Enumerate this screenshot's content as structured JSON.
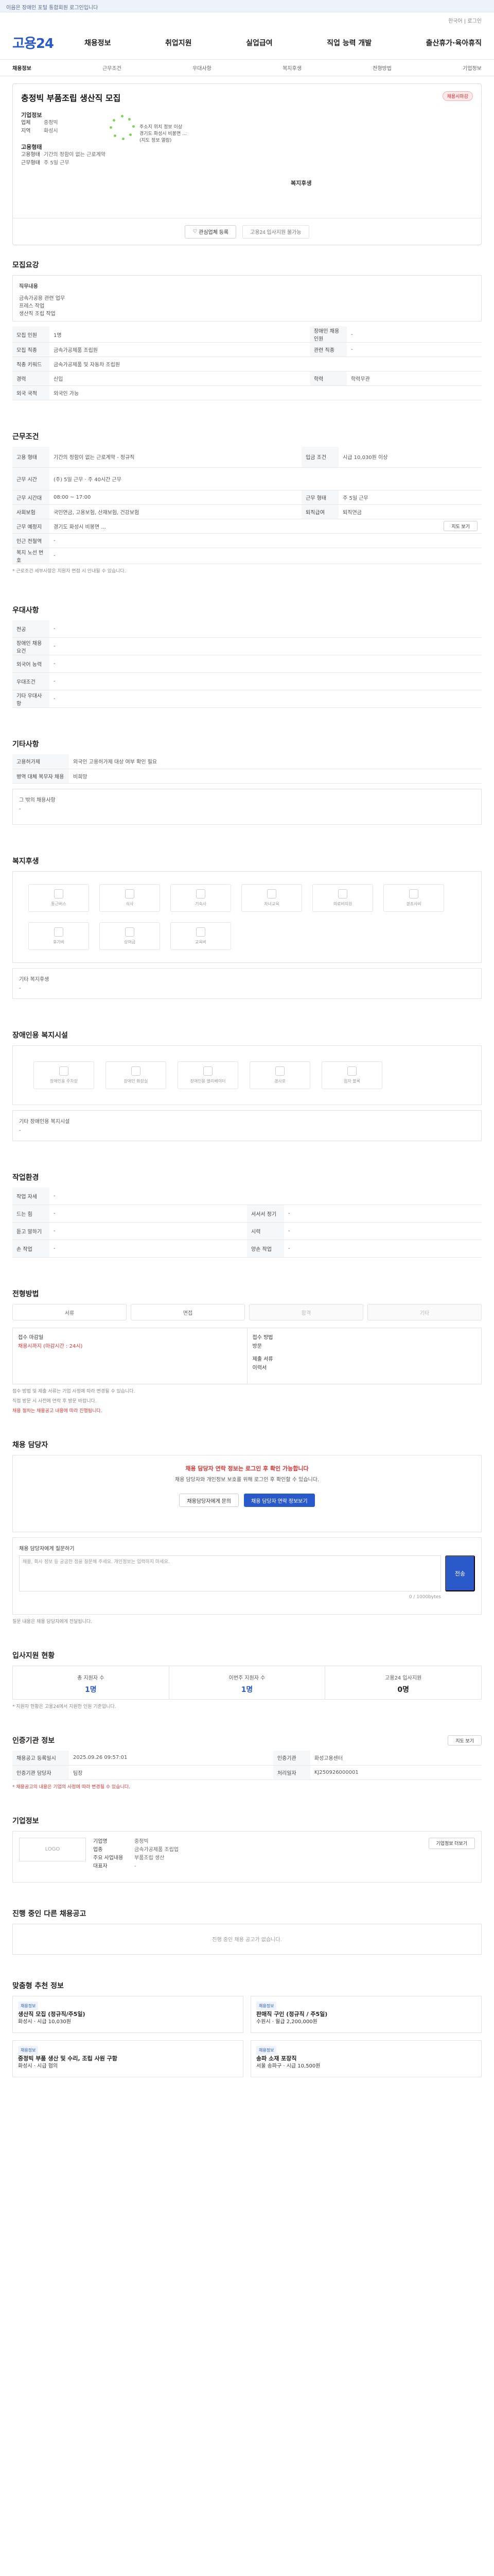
{
  "topbar": {
    "text": "이음은 장애인 포털 통합회원 로그인입니다"
  },
  "lang": {
    "label": "한국어 | 로그인"
  },
  "header": {
    "logo": "고용24",
    "menu": [
      "채용정보",
      "취업지원",
      "실업급여",
      "직업 능력 개발",
      "출산휴가·육아휴직"
    ]
  },
  "subnav": [
    "채용정보",
    "근무조건",
    "우대사항",
    "복지후생",
    "전형방법",
    "기업정보"
  ],
  "job": {
    "title": "충정빅 부품조립 생산직 모집",
    "badge": "채용시마감",
    "company_label": "기업정보",
    "rows": [
      {
        "k": "업체",
        "v": "중정빅"
      },
      {
        "k": "지역",
        "v": "화성시"
      }
    ],
    "cond_label": "고용형태",
    "cond_rows": [
      {
        "k": "고용형태",
        "v": "기간의 정함이 없는 근로계약"
      },
      {
        "k": "근무형태",
        "v": "주 5일 근무"
      }
    ],
    "map_info": [
      "주소지 위치 정보 이상",
      "경기도 화성시 비봉면 ...",
      "(지도 정보 열람)"
    ],
    "welfare_label": "복지후생",
    "btn_save": "관심업체 등록",
    "btn_apply": "고용24 입사지원 불가능"
  },
  "recruit": {
    "title": "모집요강",
    "desc_label": "직무내용",
    "desc": [
      "금속가공용 관련 업무",
      "프레스 작업",
      "생산직 조립 작업"
    ],
    "rows": [
      [
        "모집 인원",
        "1명",
        "장애인 채용 인원",
        "-"
      ],
      [
        "모집 직종",
        "금속가공제품 조립원",
        "관련 직종",
        "-"
      ],
      [
        "직종 키워드",
        "금속가공제품 및 자동차 조립원",
        "",
        ""
      ],
      [
        "경력",
        "신입",
        "학력",
        "학력무관"
      ],
      [
        "외국 국적",
        "외국인 가능",
        "",
        ""
      ]
    ]
  },
  "work": {
    "title": "근무조건",
    "rows": [
      [
        "고용 형태",
        "기간의 정함이 없는 근로계약 - 정규직",
        "입금 조건",
        "시급 10,030원 이상"
      ],
      [
        "근무 시간",
        "(주) 5일 근무 · 주 40시간 근무",
        "",
        ""
      ],
      [
        "근무 시간대",
        "08:00 ~ 17:00",
        "근무 형태",
        "주 5일 근무"
      ],
      [
        "사회보험",
        "국민연금, 고용보험, 산재보험, 건강보험",
        "퇴직급여",
        "퇴직연금"
      ],
      [
        "근무 예정지",
        "경기도 화성시 비봉면 ...",
        "",
        ""
      ],
      [
        "인근 전철역",
        "-",
        "",
        ""
      ],
      [
        "복지 노선 번호",
        "-",
        "",
        ""
      ]
    ],
    "map_btn": "지도 보기",
    "note": "* 근로조건 세부사항은 지원자 면접 시 안내될 수 있습니다."
  },
  "prefer": {
    "title": "우대사항",
    "rows": [
      [
        "전공",
        "-"
      ],
      [
        "장애인 채용 요건",
        "-"
      ],
      [
        "외국어 능력",
        "-"
      ],
      [
        "우대조건",
        "-"
      ],
      [
        "기타 우대사항",
        "-"
      ]
    ]
  },
  "etc": {
    "title": "기타사항",
    "rows": [
      [
        "고용허가제",
        "외국인 고용허가제 대상 여부 확인 필요"
      ],
      [
        "병역 대체 복무자 채용",
        "비희망"
      ]
    ],
    "box_label": "그 밖의 채용사항",
    "box_value": "-"
  },
  "welfare": {
    "title": "복지후생",
    "tiles": [
      "통근버스",
      "식사",
      "기숙사",
      "자녀교육",
      "의료비지원",
      "경조사비",
      "휴가비",
      "상여금",
      "교육비"
    ],
    "other_label": "기타 복지후생",
    "other_value": "-"
  },
  "disability": {
    "title": "장애인용 복지시설",
    "tiles": [
      "장애인용 주차장",
      "장애인 화장실",
      "장애인용 엘리베이터",
      "경사로",
      "점자 블록"
    ],
    "other_label": "기타 장애인용 복지시설",
    "other_value": "-"
  },
  "env": {
    "title": "작업환경",
    "rows": [
      [
        "작업 자세",
        "-",
        "",
        ""
      ],
      [
        "드는 힘",
        "-",
        "서서서 정기",
        "-"
      ],
      [
        "듣고 말하기",
        "-",
        "시력",
        "-"
      ],
      [
        "손 작업",
        "-",
        "양손 작업",
        "-"
      ]
    ]
  },
  "process": {
    "title": "전형방법",
    "steps": [
      "서류",
      "면접",
      "합격",
      "기타"
    ],
    "deadline_label": "접수 마감일",
    "deadline": "채용시까지 (마감시간 : 24시)",
    "method_label": "접수 방법",
    "method": "방문",
    "docs_label": "제출 서류",
    "docs": "이력서",
    "notes": [
      "접수 방법 및 제출 서류는 기업 사정에 따라 변경될 수 있습니다.",
      "직접 방문 시 사전에 연락 후 방문 바랍니다.",
      "채용 절차는 채용공고 내용에 따라 진행됩니다."
    ]
  },
  "contact": {
    "title": "채용 담당자",
    "warn": "채용 담당자 연락 정보는 로그인 후 확인 가능합니다",
    "body": "채용 담당자와 개인정보 보호를 위해 로그인 후 확인할 수 있습니다.",
    "btn1": "채용담당자에게 문의",
    "btn2": "채용 담당자 연락 정보보기",
    "qa_label": "채용 담당자에게 질문하기",
    "qa_placeholder": "채용, 회사 정보 등 궁금한 점을 질문해 주세요. 개인정보는 입력하지 마세요.",
    "send": "전송",
    "counter": "0 / 1000bytes",
    "note": "질문 내용은 채용 담당자에게 전달됩니다."
  },
  "stats": {
    "title": "입사지원 현황",
    "cols": [
      [
        "총 지원자 수",
        "1명"
      ],
      [
        "이번주 지원자 수",
        "1명"
      ],
      [
        "고용24 입사지원",
        "0명"
      ]
    ],
    "note": "* 지원자 현황은 고용24에서 지원한 인원 기준입니다."
  },
  "info": {
    "title": "인증기관 정보",
    "rows": [
      [
        "채용공고 등록일시",
        "2025.09.26 09:57:01",
        "인증기관",
        "화성고용센터"
      ],
      [
        "인증기관 담당자",
        "팀장",
        "처리일자",
        "KJ250926000001"
      ]
    ],
    "btn": "지도 보기",
    "note": "* 채용공고의 내용은 기업의 사정에 따라 변경될 수 있습니다."
  },
  "company": {
    "title": "기업정보",
    "logo": "LOGO",
    "rows": [
      [
        "기업명",
        "중정빅"
      ],
      [
        "업종",
        "금속가공제품 조립업"
      ],
      [
        "주요 사업내용",
        "부품조립 생산"
      ],
      [
        "대표자",
        "-"
      ]
    ],
    "btn": "기업정보 더보기"
  },
  "other": {
    "title": "진행 중인 다른 채용공고",
    "empty": "진행 중인 채용 공고가 없습니다."
  },
  "recs": {
    "title": "맞춤형 추천 정보",
    "items": [
      {
        "tag": "채용정보",
        "t": "생산직 모집 (정규직/주5일)",
        "d": "화성시 · 시급 10,030원"
      },
      {
        "tag": "채용정보",
        "t": "판매직 구인 (정규직 / 주5일)",
        "d": "수원시 · 월급 2,200,000원"
      },
      {
        "tag": "채용정보",
        "t": "중정빅 부품 생산 및 수리, 조립 사원 구함",
        "d": "화성시 · 시급 협의"
      },
      {
        "tag": "채용정보",
        "t": "송파 소재 포장직",
        "d": "서울 송파구 · 시급 10,500원"
      }
    ]
  }
}
